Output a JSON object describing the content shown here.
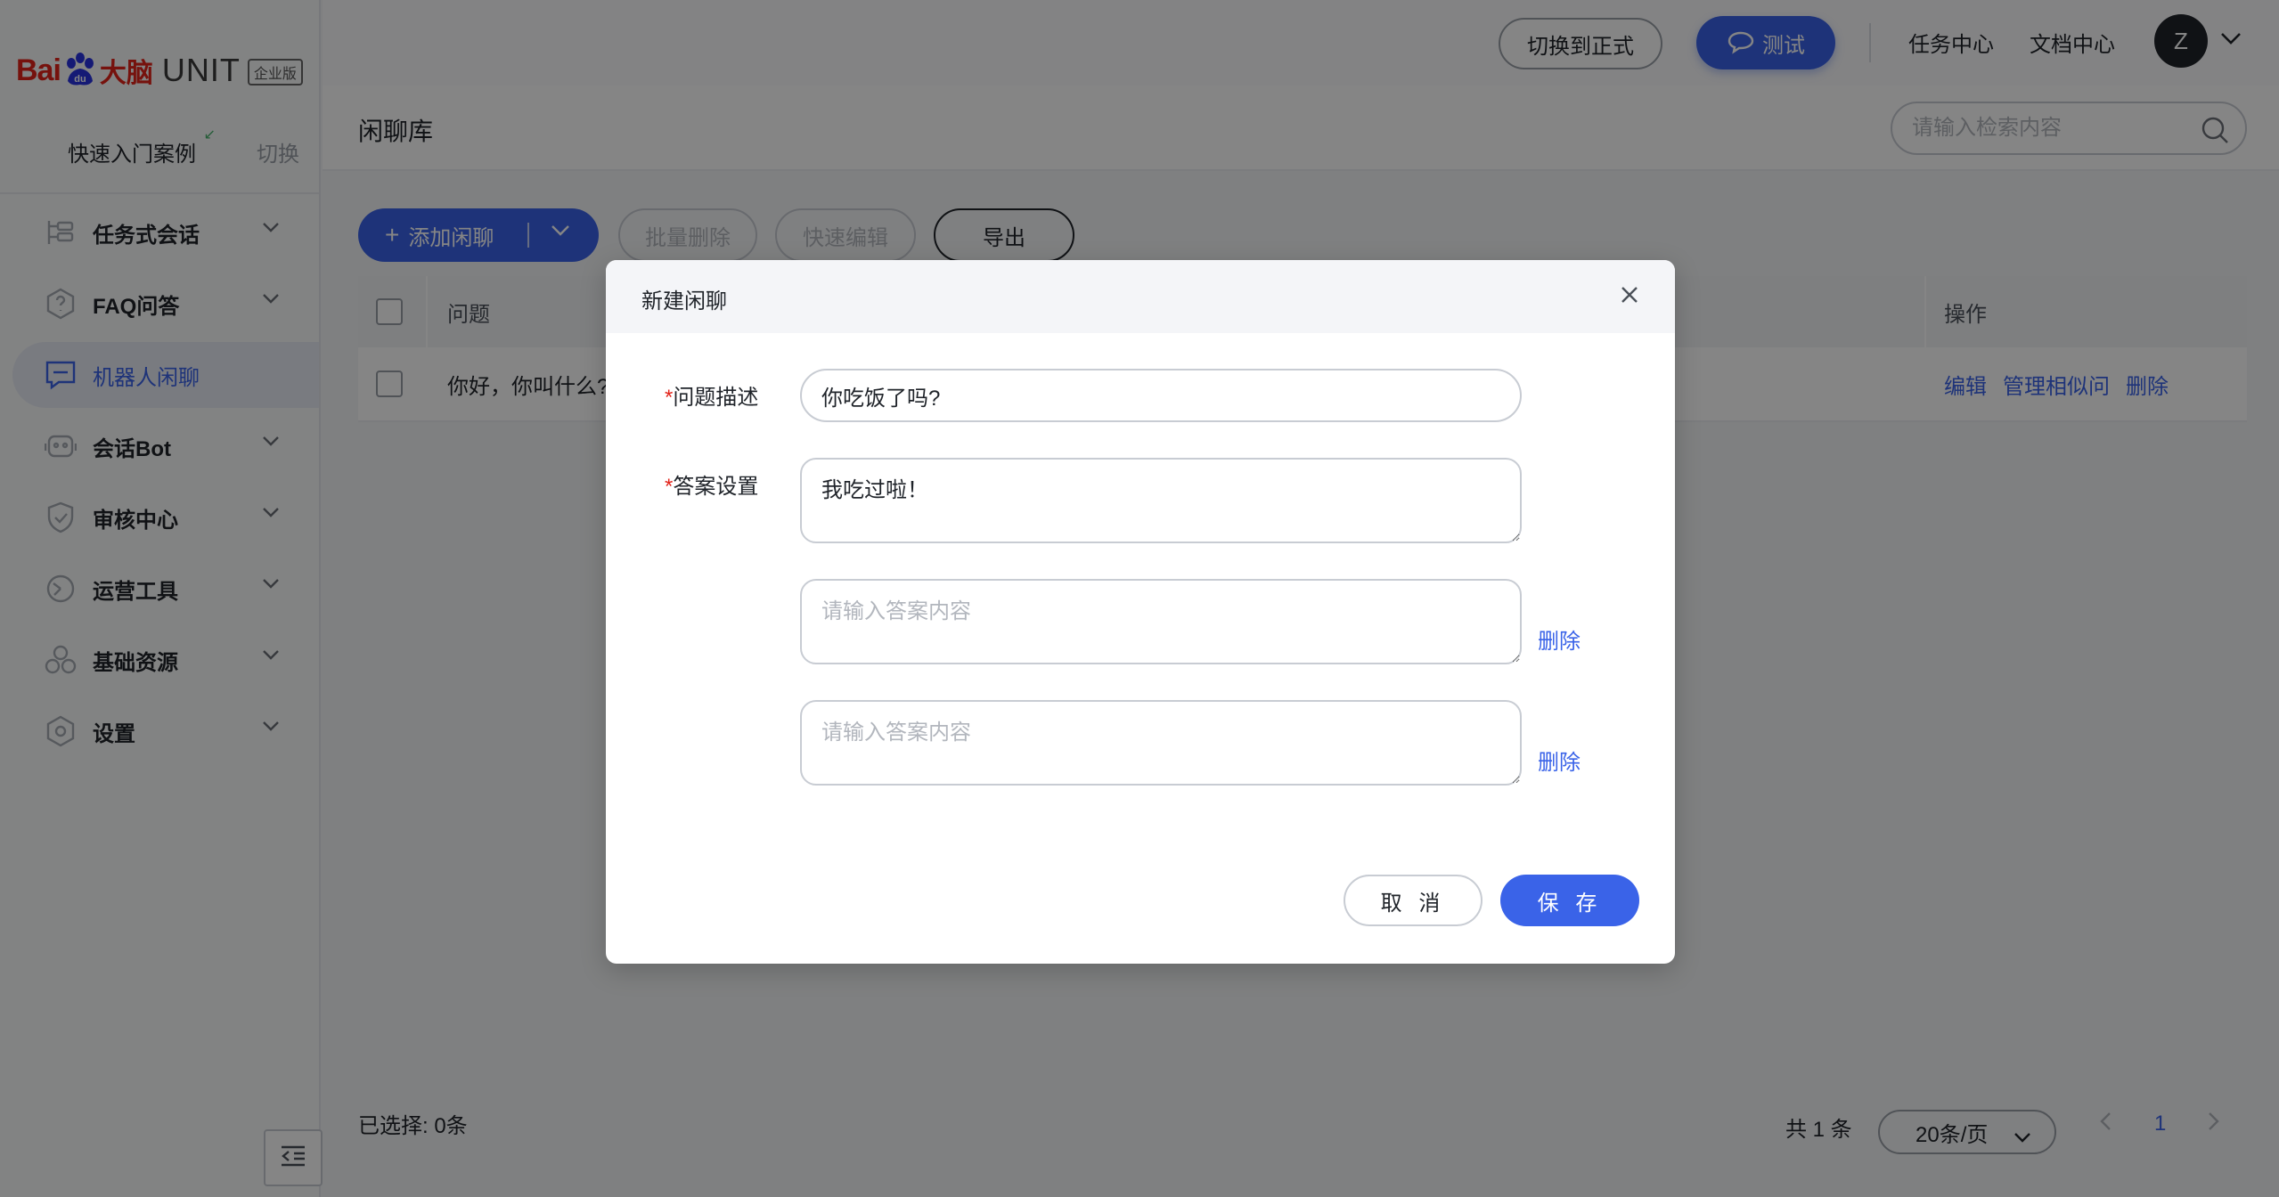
{
  "brand": {
    "bai": "Bai",
    "du": "du",
    "da": "大脑",
    "unit": "UNIT",
    "edition": "企业版"
  },
  "case": {
    "name": "快速入门案例",
    "switch_label": "切换"
  },
  "sidebar": {
    "items": [
      {
        "label": "任务式会话",
        "icon": "task-tree-icon"
      },
      {
        "label": "FAQ问答",
        "icon": "question-shield-icon"
      },
      {
        "label": "机器人闲聊",
        "icon": "chat-bubble-icon",
        "active": true
      },
      {
        "label": "会话Bot",
        "icon": "robot-icon"
      },
      {
        "label": "审核中心",
        "icon": "shield-check-icon"
      },
      {
        "label": "运营工具",
        "icon": "gauge-icon"
      },
      {
        "label": "基础资源",
        "icon": "hexagon-cluster-icon"
      },
      {
        "label": "设置",
        "icon": "gear-icon"
      }
    ]
  },
  "topbar": {
    "switch_formal": "切换到正式",
    "test_label": "测试",
    "task_center": "任务中心",
    "doc_center": "文档中心",
    "avatar_initial": "Z"
  },
  "page": {
    "title": "闲聊库",
    "search_placeholder": "请输入检索内容"
  },
  "toolbar": {
    "add_label": "添加闲聊",
    "batch_delete": "批量删除",
    "quick_edit": "快速编辑",
    "export": "导出"
  },
  "table": {
    "col_question": "问题",
    "col_ops": "操作",
    "rows": [
      {
        "question": "你好，你叫什么?",
        "ops": [
          "编辑",
          "管理相似问",
          "删除"
        ]
      }
    ]
  },
  "footer": {
    "selected": "已选择: 0条",
    "total": "共 1 条",
    "page_size": "20条/页",
    "current_page": "1"
  },
  "modal": {
    "title": "新建闲聊",
    "question_label": "问题描述",
    "question_value": "你吃饭了吗?",
    "answer_label": "答案设置",
    "answers": [
      {
        "value": "我吃过啦！",
        "placeholder": ""
      },
      {
        "value": "",
        "placeholder": "请输入答案内容",
        "delete": "删除"
      },
      {
        "value": "",
        "placeholder": "请输入答案内容",
        "delete": "删除"
      }
    ],
    "cancel": "取 消",
    "save": "保 存"
  },
  "colors": {
    "primary": "#3a63e8",
    "brand_red": "#e2231a"
  }
}
